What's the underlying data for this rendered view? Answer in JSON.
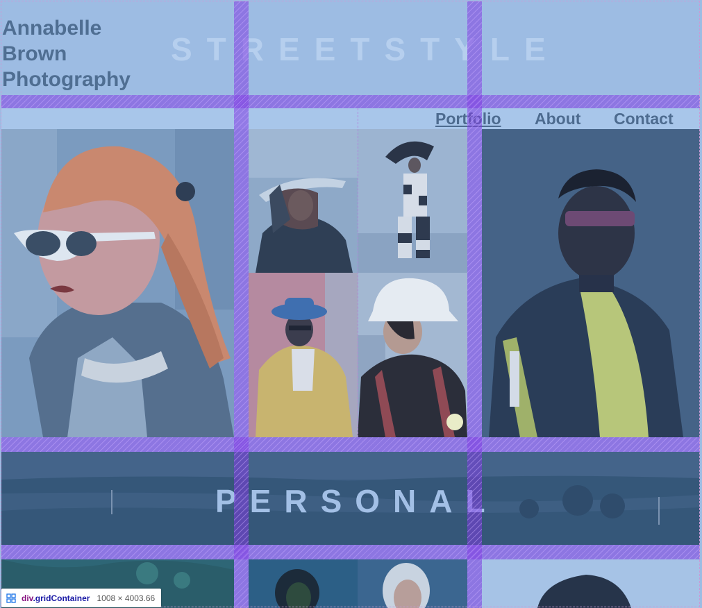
{
  "header": {
    "brand_lines": [
      "Annabelle",
      "Brown",
      "Photography"
    ],
    "watermark": "STREETSTYLE"
  },
  "nav": {
    "items": [
      {
        "label": "Portfolio",
        "active": true
      },
      {
        "label": "About",
        "active": false
      },
      {
        "label": "Contact",
        "active": false
      }
    ]
  },
  "sections": {
    "personal_title": "PERSONAL"
  },
  "devtools": {
    "tag": "div",
    "class_name": ".gridContainer",
    "size": "1008 × 4003.66",
    "overlay_color": "#7f3ce2"
  },
  "colors": {
    "page_background": "#9dbce3",
    "brand_text": "#4f6e92",
    "nav_text": "#4d6b8f",
    "band_background": "#36597e"
  }
}
